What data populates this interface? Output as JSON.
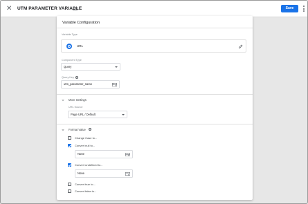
{
  "header": {
    "title": "UTM PARAMETER VARIABLE",
    "save_label": "Save"
  },
  "card": {
    "title": "Variable Configuration",
    "variable_type_label": "Variable Type",
    "variable_type_value": "URL",
    "component_type_label": "Component Type",
    "component_type_value": "Query",
    "query_key_label": "Query Key",
    "query_key_value": "utm_parameter_name",
    "more_settings_title": "More Settings",
    "url_source_label": "URL Source",
    "url_source_value": "Page URL / Default",
    "format_value_title": "Format Value",
    "options": [
      {
        "label": "Change Case to...",
        "checked": false
      },
      {
        "label": "Convert null to...",
        "checked": true,
        "value": "None"
      },
      {
        "label": "Convert undefined to...",
        "checked": true,
        "value": "None"
      },
      {
        "label": "Convert true to...",
        "checked": false
      },
      {
        "label": "Convert false to...",
        "checked": false
      }
    ]
  },
  "colors": {
    "accent": "#1a73e8",
    "background": "#e7e7e7"
  }
}
